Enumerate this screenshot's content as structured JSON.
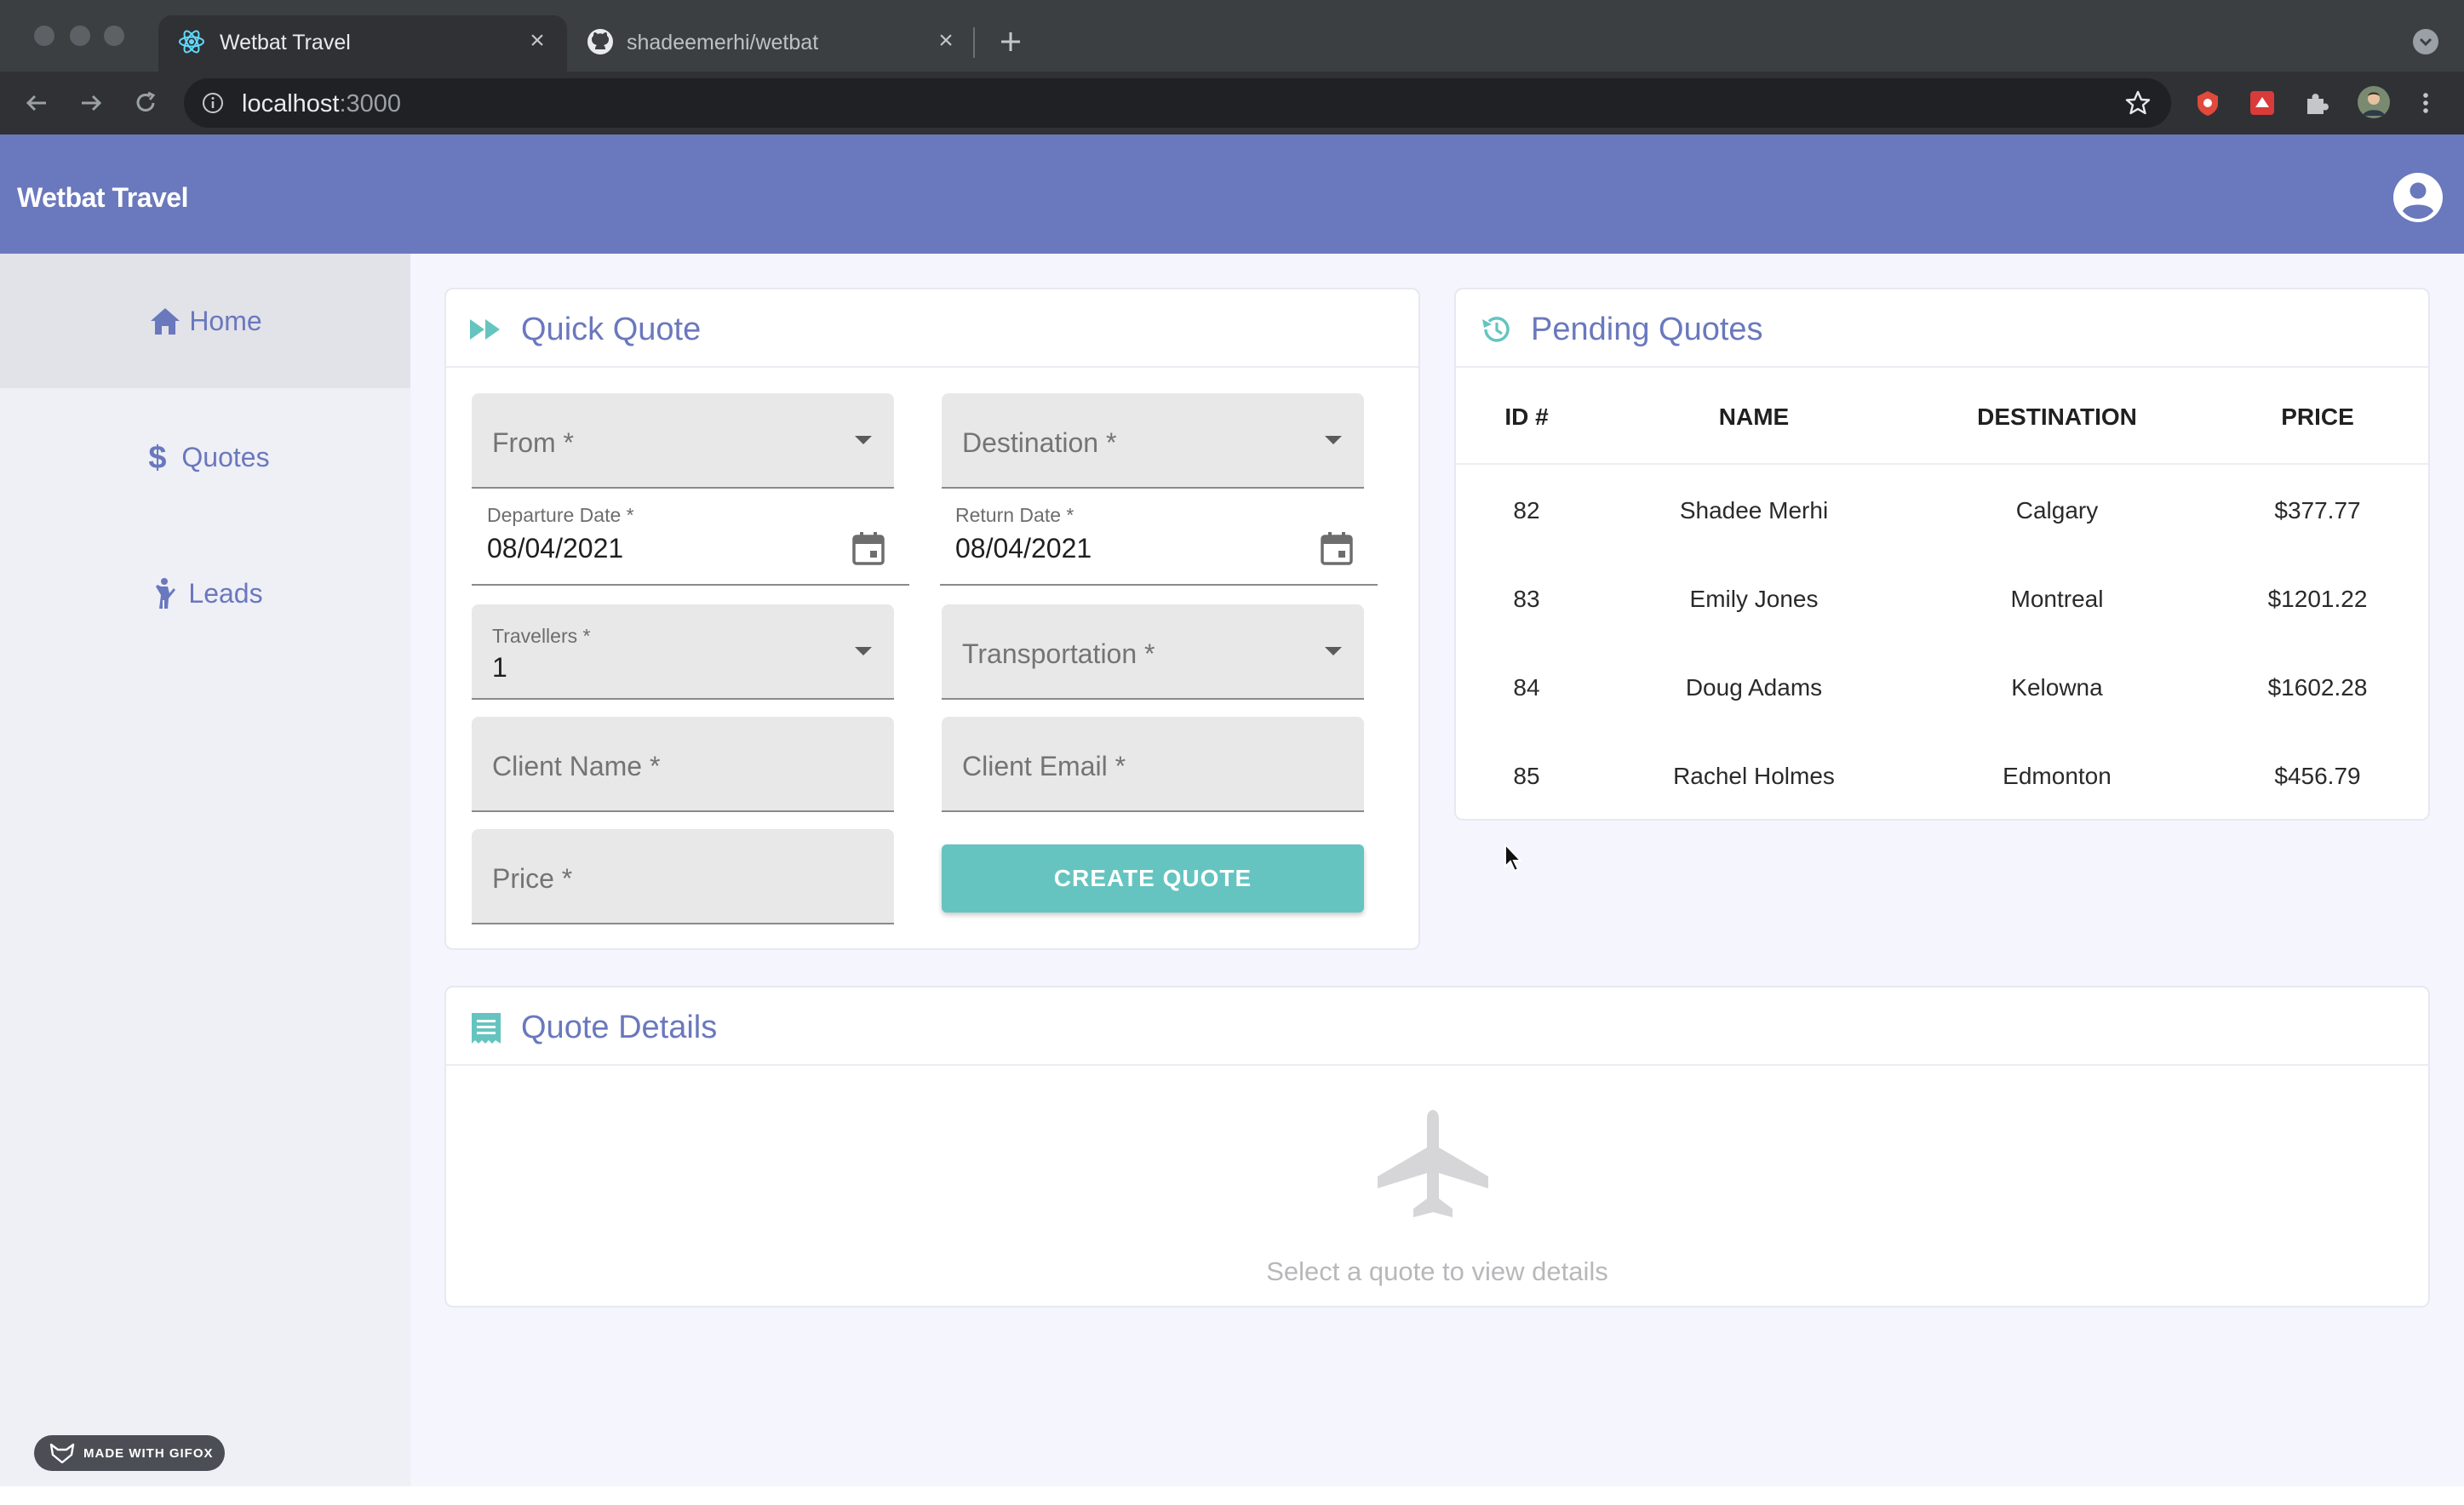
{
  "browser": {
    "tabs": [
      {
        "title": "Wetbat Travel",
        "icon": "react-icon",
        "active": true
      },
      {
        "title": "shadeemerhi/wetbat",
        "icon": "github-icon",
        "active": false
      }
    ],
    "url_host": "localhost",
    "url_port": ":3000",
    "extensions": [
      "shield-extension-icon",
      "red-extension-icon",
      "puzzle-icon",
      "profile-avatar"
    ]
  },
  "app": {
    "title": "Wetbat Travel",
    "accent": "#6a78bd",
    "teal": "#65c4c0"
  },
  "sidebar": {
    "items": [
      {
        "label": "Home",
        "icon": "home-icon",
        "active": true
      },
      {
        "label": "Quotes",
        "icon": "dollar-icon",
        "active": false
      },
      {
        "label": "Leads",
        "icon": "person-icon",
        "active": false
      }
    ]
  },
  "quick_quote": {
    "title": "Quick Quote",
    "from_label": "From *",
    "destination_label": "Destination *",
    "departure_label": "Departure Date *",
    "departure_value": "08/04/2021",
    "return_label": "Return Date *",
    "return_value": "08/04/2021",
    "travellers_label": "Travellers *",
    "travellers_value": "1",
    "transportation_label": "Transportation *",
    "client_name_label": "Client Name *",
    "client_email_label": "Client Email *",
    "price_label": "Price *",
    "create_button": "CREATE QUOTE"
  },
  "pending_quotes": {
    "title": "Pending Quotes",
    "columns": [
      "ID #",
      "NAME",
      "DESTINATION",
      "PRICE"
    ],
    "rows": [
      {
        "id": "82",
        "name": "Shadee Merhi",
        "destination": "Calgary",
        "price": "$377.77"
      },
      {
        "id": "83",
        "name": "Emily Jones",
        "destination": "Montreal",
        "price": "$1201.22"
      },
      {
        "id": "84",
        "name": "Doug Adams",
        "destination": "Kelowna",
        "price": "$1602.28"
      },
      {
        "id": "85",
        "name": "Rachel Holmes",
        "destination": "Edmonton",
        "price": "$456.79"
      }
    ]
  },
  "quote_details": {
    "title": "Quote Details",
    "empty_message": "Select a quote to view details"
  },
  "gifox_badge": "MADE WITH GIFOX"
}
